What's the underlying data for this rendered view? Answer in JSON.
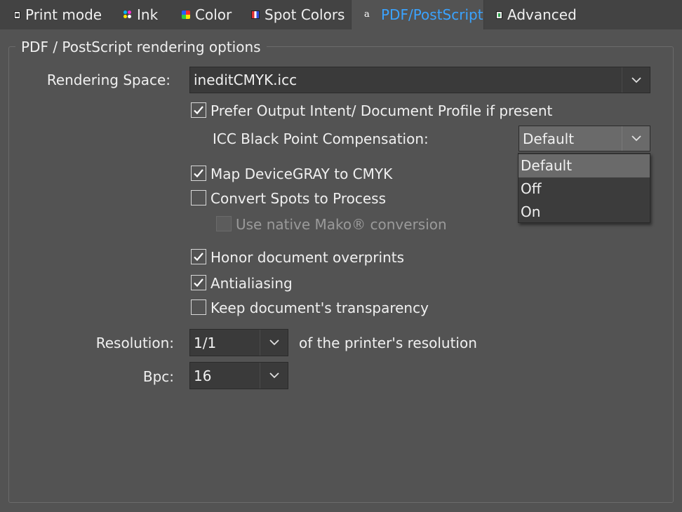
{
  "tabs": [
    {
      "label": "Print mode",
      "icon": "print-mode-icon"
    },
    {
      "label": "Ink",
      "icon": "ink-icon"
    },
    {
      "label": "Color",
      "icon": "color-icon"
    },
    {
      "label": "Spot Colors",
      "icon": "spot-colors-icon"
    },
    {
      "label": "PDF/PostScript",
      "icon": "pdf-postscript-icon",
      "icon_glyph": "a",
      "active": true
    },
    {
      "label": "Advanced",
      "icon": "advanced-icon"
    }
  ],
  "group": {
    "title": "PDF / PostScript rendering options"
  },
  "rendering_space": {
    "label": "Rendering Space:",
    "value": "ineditCMYK.icc"
  },
  "prefer_output_intent": {
    "label": "Prefer Output Intent/ Document Profile if present",
    "checked": true
  },
  "icc_bpc": {
    "label": "ICC Black Point Compensation:",
    "value": "Default",
    "options": [
      "Default",
      "Off",
      "On"
    ],
    "open": true
  },
  "map_devicegray": {
    "label": "Map DeviceGRAY to CMYK",
    "checked": true
  },
  "convert_spots": {
    "label": "Convert Spots to Process",
    "checked": false
  },
  "native_mako": {
    "label": "Use native Mako® conversion",
    "checked": false,
    "enabled": false
  },
  "honor_overprints": {
    "label": "Honor document overprints",
    "checked": true
  },
  "antialiasing": {
    "label": "Antialiasing",
    "checked": true
  },
  "keep_transparency": {
    "label": "Keep document's transparency",
    "checked": false
  },
  "resolution": {
    "label": "Resolution:",
    "value": "1/1",
    "suffix": "of the printer's resolution"
  },
  "bpc": {
    "label": "Bpc:",
    "value": "16"
  },
  "colors": {
    "background": "#535353",
    "tab_bar": "#434343",
    "active_tab_text": "#3aa3ff",
    "combo_bg": "#3a3a3a",
    "popup_bg": "#3c3c3c",
    "popup_selected": "#6a6a6a"
  }
}
